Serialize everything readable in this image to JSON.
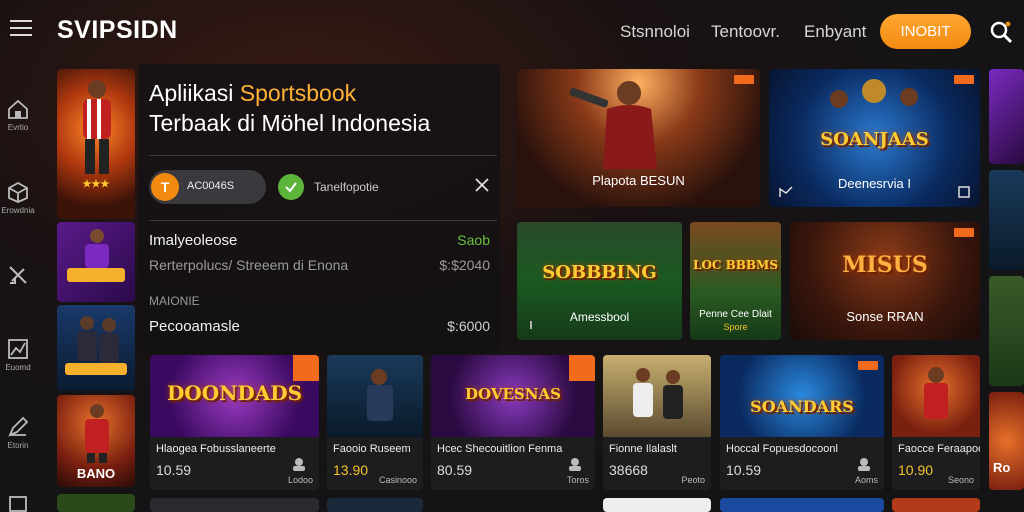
{
  "header": {
    "brand": "SVIPSIDN",
    "nav": [
      "Stsnnoloi",
      "Tentoovr.",
      "Enbyant"
    ],
    "cta_label": "INOBIT"
  },
  "rail": [
    {
      "label": "Evrtio",
      "icon": "home-icon"
    },
    {
      "label": "Erowdnia",
      "icon": "box-icon"
    },
    {
      "label": "",
      "icon": "tools-icon"
    },
    {
      "label": "Euomd",
      "icon": "chart-icon"
    },
    {
      "label": "Etorin",
      "icon": "pen-icon"
    }
  ],
  "thumbs": [
    {
      "label": ""
    },
    {
      "label": ""
    },
    {
      "label": ""
    },
    {
      "label": "BANO"
    }
  ],
  "feature": {
    "title_plain": "Apliikasi ",
    "title_highlight": "Sportsbook",
    "title_line2": "Terbaak di Möhel Indonesia",
    "pill_label": "AC0046S",
    "pill_icon_text": "T",
    "secondary_label": "Tanelfopotie",
    "rows": [
      {
        "title": "Imalyeoleose",
        "value": "Saob",
        "value_color": "#69c23e"
      },
      {
        "subtitle": "Rerterpolucs/ Streeem di Enona",
        "value": "$:$2040",
        "value_color": "#9a9a9a"
      },
      {
        "subtitle": "MAIONIE"
      },
      {
        "title": "Pecooamasle",
        "value": "$:6000",
        "value_color": "#cfcfcf"
      }
    ]
  },
  "top_cards": [
    {
      "title": "Plapota BESUN"
    },
    {
      "title": "Deenesrvia I",
      "logo": "SOANJAAS"
    }
  ],
  "mid_cards": [
    {
      "title": "Amessbool",
      "logo": "SOBBBING"
    },
    {
      "title": "Penne Cee Dlait",
      "subtitle": "Spore",
      "logo": "LOC BBBMS"
    },
    {
      "title": "Sonse RRAN",
      "logo": "MISUS"
    }
  ],
  "bottom_cards": [
    {
      "title": "Hlaogea Fobusslaneerte",
      "price": "10.59",
      "sub": "Lodoo",
      "logo": "DOONDADS"
    },
    {
      "title": "Faooio Ruseem",
      "price": "13.90",
      "sub": "Casinooo",
      "price_yellow": true
    },
    {
      "title": "Hcec Shecouitlion Fenma",
      "price": "80.59",
      "sub": "Toros",
      "logo": "DOVESNAS"
    },
    {
      "title": "Fionne Ilalaslt",
      "price": "38668",
      "sub": "Peoto"
    },
    {
      "title": "Hoccal Fopuesdocoonl",
      "price": "10.59",
      "sub": "Aoms",
      "logo": "SOANDARS"
    },
    {
      "title": "Faocce Feraapoor",
      "price": "10.90",
      "sub": "Seono",
      "price_yellow": true
    }
  ],
  "right_strip": [
    "Ro"
  ]
}
